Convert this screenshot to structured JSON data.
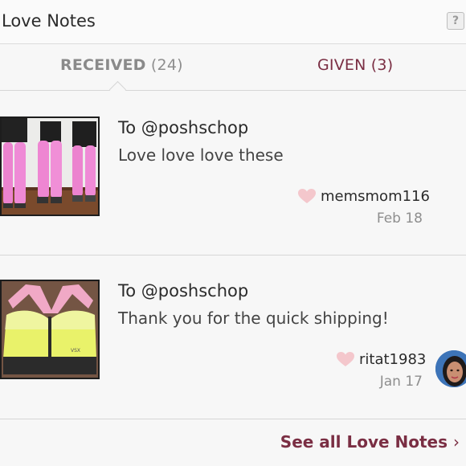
{
  "header": {
    "title": "Love Notes",
    "help_label": "?"
  },
  "tabs": [
    {
      "label": "RECEIVED",
      "count": "(24)"
    },
    {
      "label": "GIVEN",
      "count": "(3)"
    }
  ],
  "notes": [
    {
      "to": "To @poshschop",
      "message": "Love love love these",
      "username": "memsmom116",
      "date": "Feb 18"
    },
    {
      "to": "To @poshschop",
      "message": "Thank you for the quick shipping!",
      "username": "ritat1983",
      "date": "Jan 17"
    }
  ],
  "footer": {
    "see_all_label": "See all Love Notes",
    "chevron": "›"
  },
  "colors": {
    "accent": "#7a2e43",
    "heart": "#f4c7cc",
    "divider": "#d6d6d6"
  }
}
